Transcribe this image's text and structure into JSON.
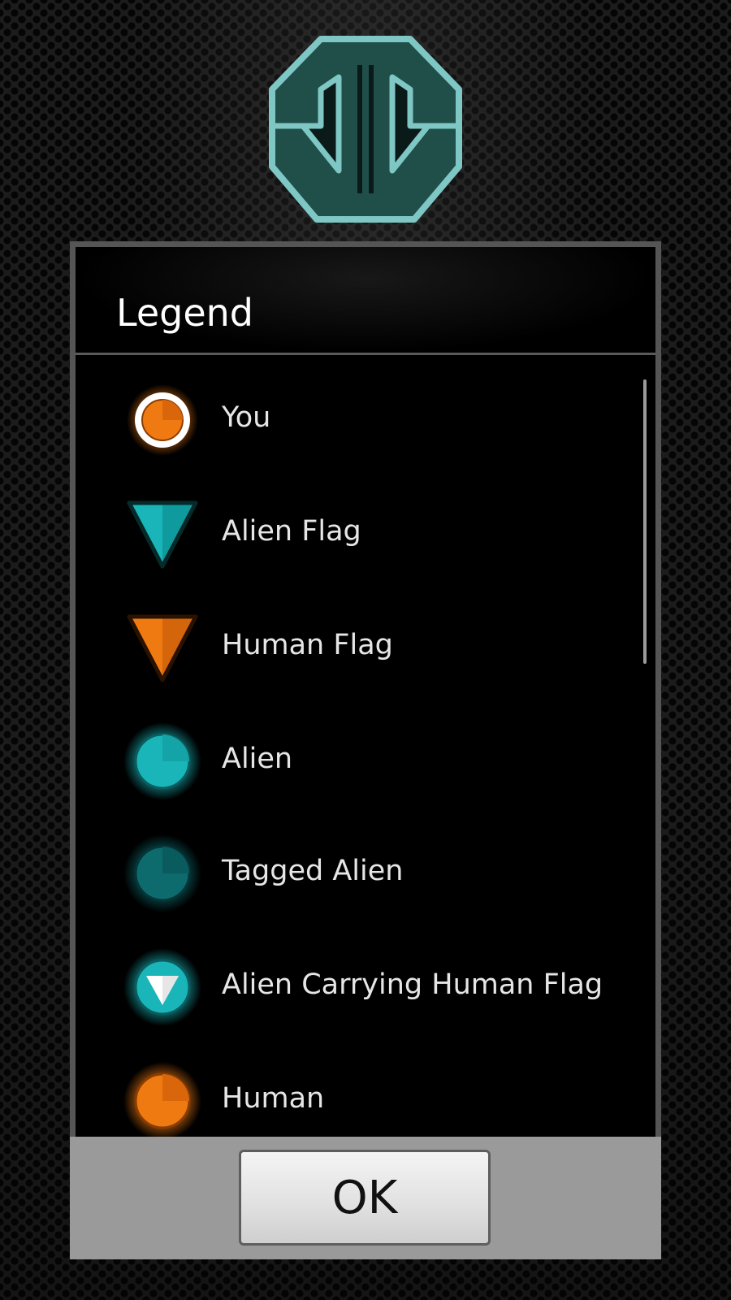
{
  "logo": {
    "icon": "team-emblem-icon",
    "color": "#7ec7c4",
    "fill": "#1f4f48"
  },
  "dialog": {
    "title": "Legend",
    "items": [
      {
        "label": "You",
        "icon": "you-marker-icon"
      },
      {
        "label": "Alien Flag",
        "icon": "alien-flag-icon"
      },
      {
        "label": "Human Flag",
        "icon": "human-flag-icon"
      },
      {
        "label": "Alien",
        "icon": "alien-marker-icon"
      },
      {
        "label": "Tagged Alien",
        "icon": "tagged-alien-marker-icon"
      },
      {
        "label": "Alien Carrying Human Flag",
        "icon": "alien-carrying-flag-icon"
      },
      {
        "label": "Human",
        "icon": "human-marker-icon"
      }
    ],
    "ok_label": "OK"
  },
  "colors": {
    "alien": "#19b5b8",
    "tagged_alien": "#0d6b6e",
    "human": "#f07a12",
    "you_ring": "#ffffff"
  }
}
